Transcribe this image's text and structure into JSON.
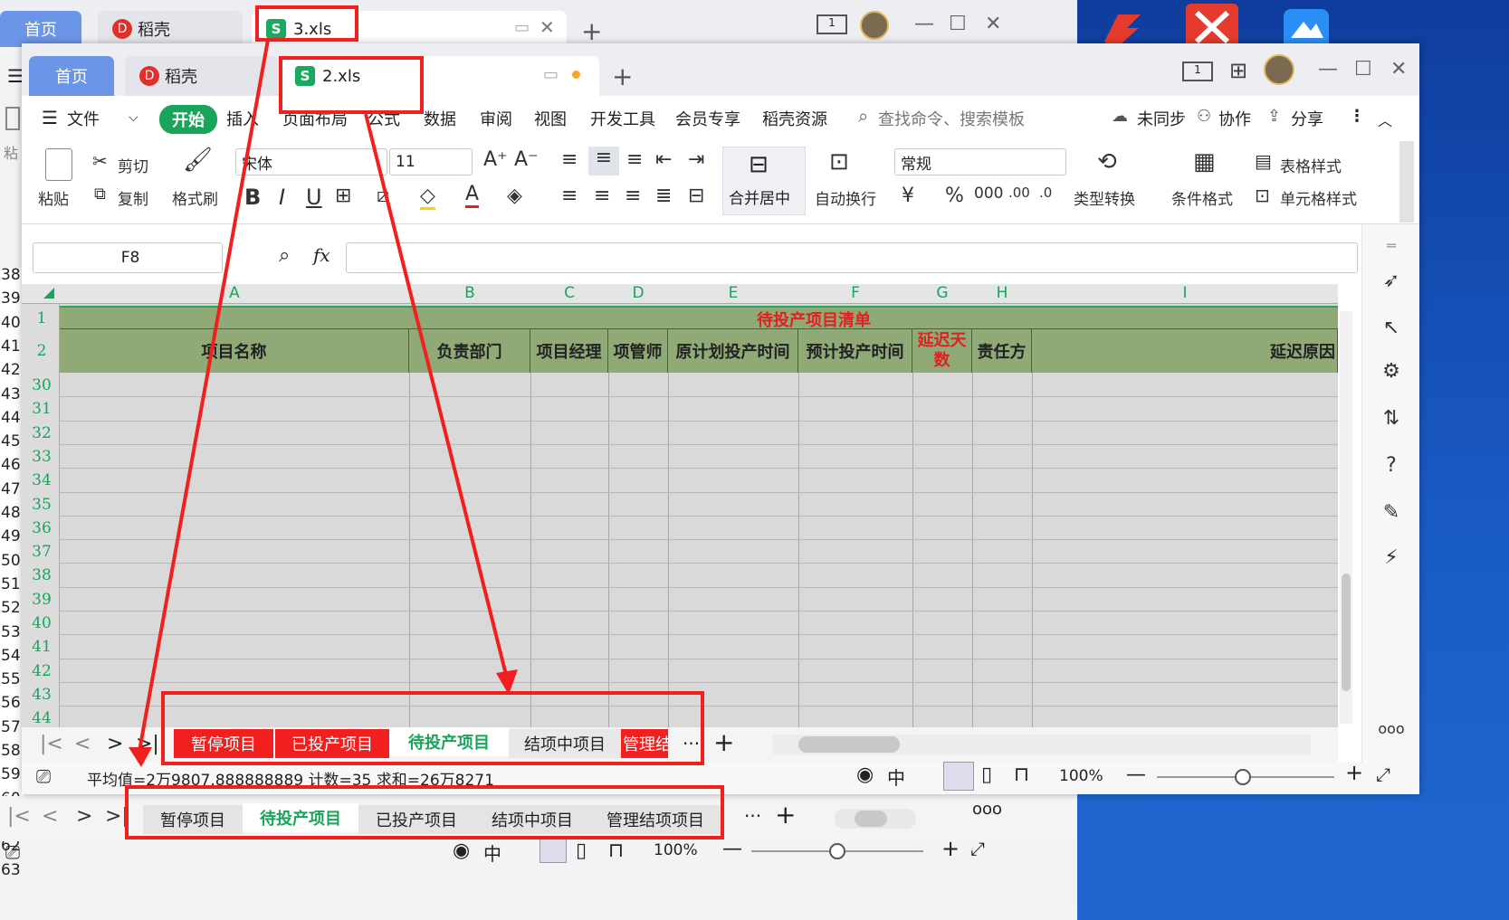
{
  "back_window": {
    "tabs": {
      "home": "首页",
      "daoke": "稻壳",
      "file": "3.xls"
    },
    "add_tab": "+",
    "sheet_tabs": [
      "暂停项目",
      "待投产项目",
      "已投产项目",
      "结项中项目",
      "管理结项项目"
    ],
    "active_sheet": "待投产项目",
    "zoom": "100%",
    "left_rows": [
      "38",
      "39",
      "40",
      "41",
      "42",
      "43",
      "44",
      "45",
      "46",
      "47",
      "48",
      "49",
      "50",
      "51",
      "52",
      "53",
      "54",
      "55",
      "56",
      "57",
      "58",
      "59",
      "60",
      "61",
      "62",
      "63"
    ],
    "side_label": "粘"
  },
  "front_window": {
    "tabs": {
      "home": "首页",
      "daoke": "稻壳",
      "file": "2.xls"
    },
    "add_tab": "+",
    "menu": {
      "file": "文件",
      "start": "开始",
      "items": [
        "插入",
        "页面布局",
        "公式",
        "数据",
        "审阅",
        "视图",
        "开发工具",
        "会员专享",
        "稻壳资源"
      ],
      "search": "查找命令、搜索模板",
      "sync": "未同步",
      "collab": "协作",
      "share": "分享"
    },
    "ribbon": {
      "paste": "粘贴",
      "cut": "剪切",
      "copy": "复制",
      "format_painter": "格式刷",
      "font_name": "宋体",
      "font_size": "11",
      "merge": "合并居中",
      "wrap": "自动换行",
      "number_format": "常规",
      "type_convert": "类型转换",
      "cond_format": "条件格式",
      "table_style": "表格样式",
      "cell_style": "单元格样式"
    },
    "formula_bar": {
      "cell_ref": "F8",
      "fx": "fx",
      "value": ""
    },
    "columns": [
      "A",
      "B",
      "C",
      "D",
      "E",
      "F",
      "G",
      "H",
      "I"
    ],
    "sheet": {
      "title": "待投产项目清单",
      "headers": [
        "项目名称",
        "负责部门",
        "项目经理",
        "项管师",
        "原计划投产时间",
        "预计投产时间",
        "延迟天数",
        "责任方",
        "延迟原因"
      ],
      "header_delay_line1": "延迟天",
      "header_delay_line2": "数",
      "top_rows": [
        "1",
        "2"
      ],
      "rows": [
        "30",
        "31",
        "32",
        "33",
        "34",
        "35",
        "36",
        "37",
        "38",
        "39",
        "40",
        "41",
        "42",
        "43",
        "44"
      ]
    },
    "sheet_tabs": [
      "暂停项目",
      "已投产项目",
      "待投产项目",
      "结项中项目",
      "管理结"
    ],
    "active_sheet": "待投产项目",
    "more": "···",
    "status": "平均值=2万9807.888888889  计数=35  求和=26万8271",
    "zoom": "100%"
  },
  "colors": {
    "accent_green": "#1aa35a",
    "highlight_red": "#f21f1f",
    "header_green": "#8faa77",
    "tab_blue": "#6b95e6"
  }
}
